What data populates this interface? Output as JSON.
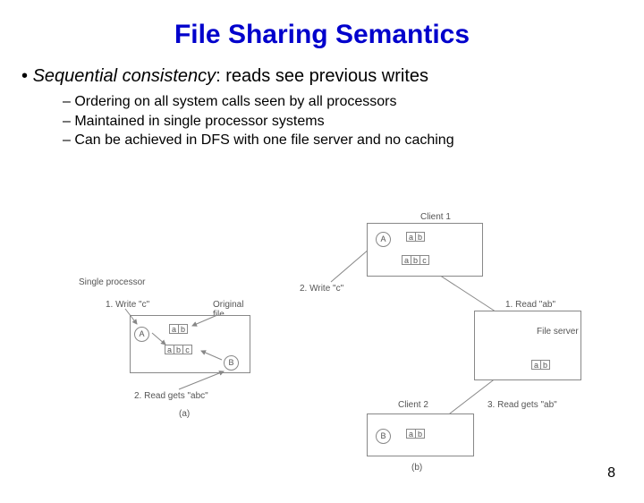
{
  "title": "File Sharing Semantics",
  "bullet": {
    "em": "Sequential consistency",
    "rest": ": reads see previous writes"
  },
  "subs": [
    "Ordering on all system calls seen by all processors",
    "Maintained in single processor systems",
    "Can be achieved in DFS with one file server and no caching"
  ],
  "diag_a": {
    "single_processor": "Single processor",
    "write": "1. Write \"c\"",
    "original_file": "Original\nfile",
    "read": "2. Read gets \"abc\"",
    "cap_a": "(a)",
    "circA": "A",
    "circB": "B",
    "ab": [
      "a",
      "b"
    ],
    "abc": [
      "a",
      "b",
      "c"
    ]
  },
  "diag_b": {
    "client1": "Client 1",
    "client2": "Client 2",
    "file_server": "File server",
    "read1": "1. Read \"ab\"",
    "write2": "2. Write \"c\"",
    "read3": "3. Read gets \"ab\"",
    "cap_b": "(b)",
    "circA": "A",
    "circB": "B",
    "ab1": [
      "a",
      "b"
    ],
    "abc": [
      "a",
      "b",
      "c"
    ],
    "ab2": [
      "a",
      "b"
    ],
    "ab3": [
      "a",
      "b"
    ]
  },
  "page": "8"
}
